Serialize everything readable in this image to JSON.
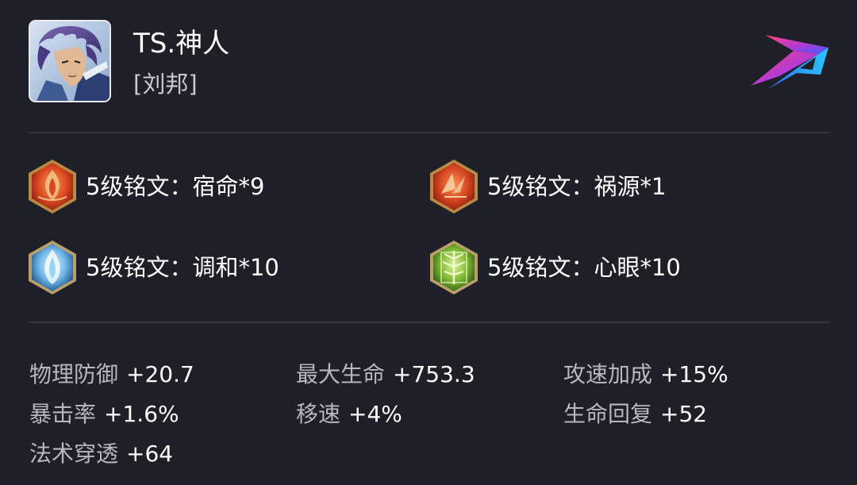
{
  "header": {
    "player_name": "TS.神人",
    "hero_name": "[刘邦]"
  },
  "runes": [
    {
      "text": "5级铭文：宿命*9",
      "icon": "red-flame-rune-icon"
    },
    {
      "text": "5级铭文：祸源*1",
      "icon": "red-shards-rune-icon"
    },
    {
      "text": "5级铭文：调和*10",
      "icon": "blue-crystal-rune-icon"
    },
    {
      "text": "5级铭文：心眼*10",
      "icon": "green-leaf-rune-icon"
    }
  ],
  "stats": [
    {
      "label": "物理防御",
      "value": "+20.7"
    },
    {
      "label": "最大生命",
      "value": "+753.3"
    },
    {
      "label": "攻速加成",
      "value": "+15%"
    },
    {
      "label": "暴击率",
      "value": "+1.6%"
    },
    {
      "label": "移速",
      "value": "+4%"
    },
    {
      "label": "生命回复",
      "value": "+52"
    },
    {
      "label": "法术穿透",
      "value": "+64"
    }
  ],
  "colors": {
    "background": "#1f1f27",
    "divider": "#34343e",
    "label": "#b7b7c0",
    "value": "#ffffff"
  }
}
